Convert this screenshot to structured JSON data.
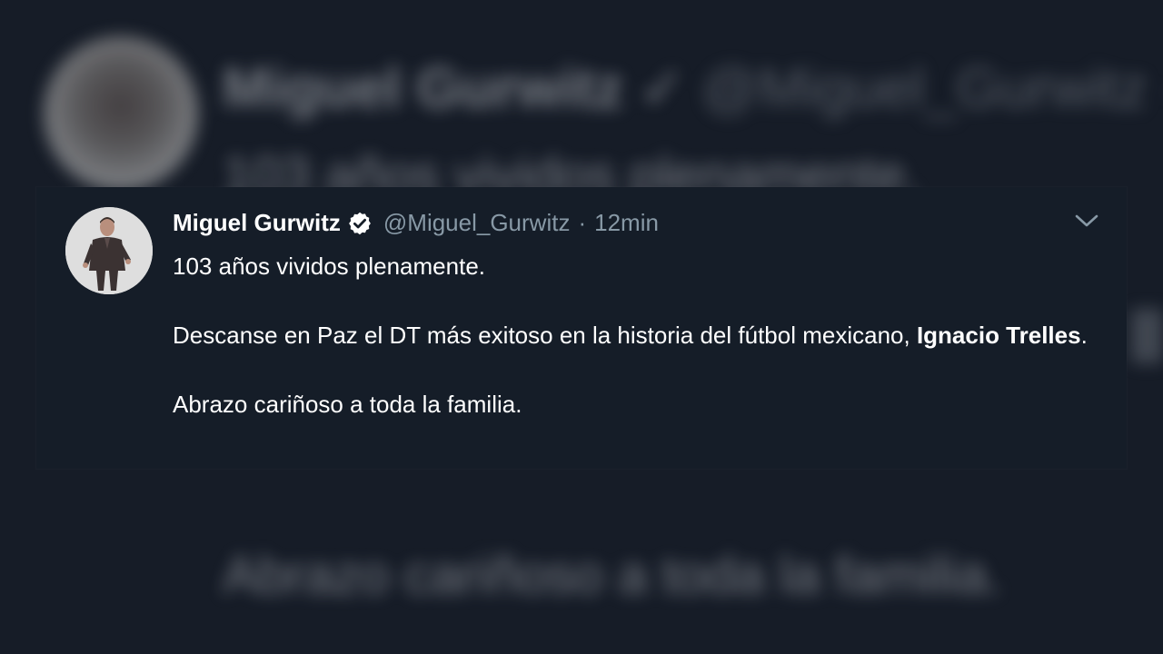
{
  "tweet": {
    "display_name": "Miguel Gurwitz",
    "handle": "@Miguel_Gurwitz",
    "separator": "·",
    "time": "12min",
    "verified": true,
    "line1": "103 años vividos plenamente.",
    "line2_prefix": "Descanse en Paz el DT más exitoso en la historia del fútbol mexicano, ",
    "line2_bold": "Ignacio Trelles",
    "line2_suffix": ".",
    "line3": "Abrazo  cariñoso a toda la familia."
  },
  "icons": {
    "verified": "verified-badge-icon",
    "menu": "chevron-down-icon"
  },
  "colors": {
    "background": "#151d28",
    "text_primary": "#ffffff",
    "text_secondary": "#8899a6"
  }
}
